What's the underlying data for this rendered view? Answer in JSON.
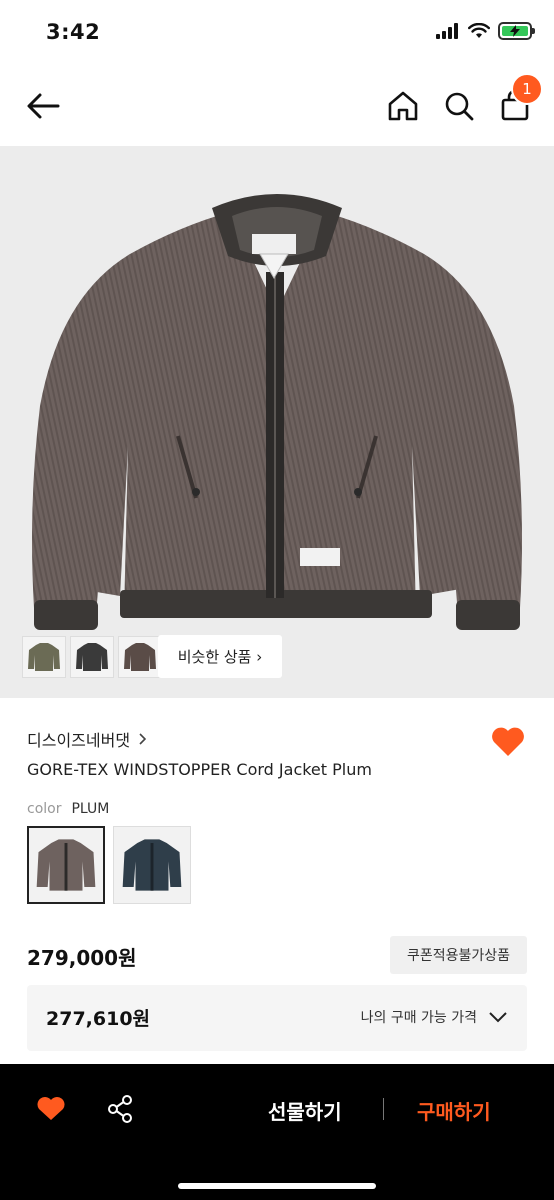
{
  "status_bar": {
    "time": "3:42"
  },
  "nav": {
    "cart_count": "1"
  },
  "gallery": {
    "similar_label": "비슷한 상품 ›"
  },
  "product": {
    "brand": "디스이즈네버댓",
    "name": "GORE-TEX WINDSTOPPER Cord Jacket Plum",
    "color_label": "color",
    "color_value": "PLUM",
    "price": "279,000원",
    "coupon_badge": "쿠폰적용불가상품",
    "my_price": "277,610원",
    "my_price_label": "나의 구매 가능 가격"
  },
  "bottom_bar": {
    "gift_label": "선물하기",
    "buy_label": "구매하기"
  },
  "colors": {
    "accent": "#ff5a1f",
    "jacket_plum": "#6e625f",
    "jacket_navy": "#2f3e4a",
    "jacket_olive": "#6b6b55"
  }
}
